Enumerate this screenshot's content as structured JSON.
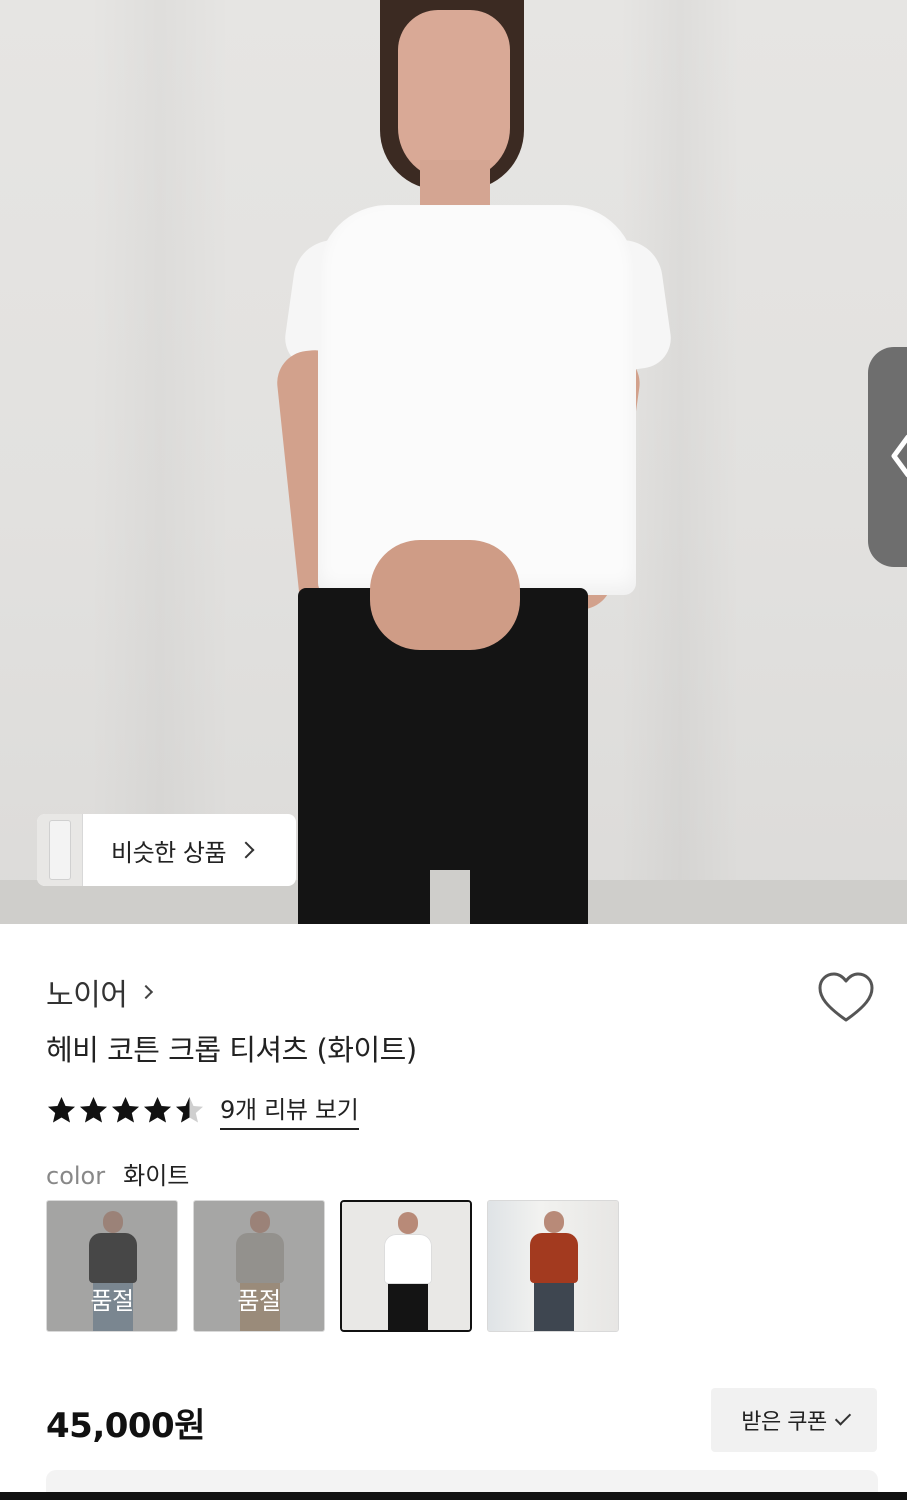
{
  "similar": {
    "label": "비슷한 상품"
  },
  "product": {
    "brand": "노이어",
    "title": "헤비 코튼 크롭 티셔츠 (화이트)",
    "rating": 4.5,
    "review_link": "9개 리뷰 보기",
    "color_key": "color",
    "color_value": "화이트",
    "swatches": [
      {
        "shirt_color": "#1f1f1f",
        "soldout_label": "품절"
      },
      {
        "shirt_color": "#a9a69f",
        "soldout_label": "품절"
      },
      {
        "shirt_color": "#ffffff",
        "soldout_label": ""
      },
      {
        "shirt_color": "#a33a1f",
        "soldout_label": ""
      }
    ],
    "price": "45,000원",
    "coupon_label": "받은 쿠폰"
  },
  "icons": [
    "chevron-right-icon",
    "heart-icon",
    "star-icon",
    "check-icon",
    "chevron-left-icon"
  ],
  "colors": {
    "accent": "#111111",
    "muted": "#888888"
  }
}
